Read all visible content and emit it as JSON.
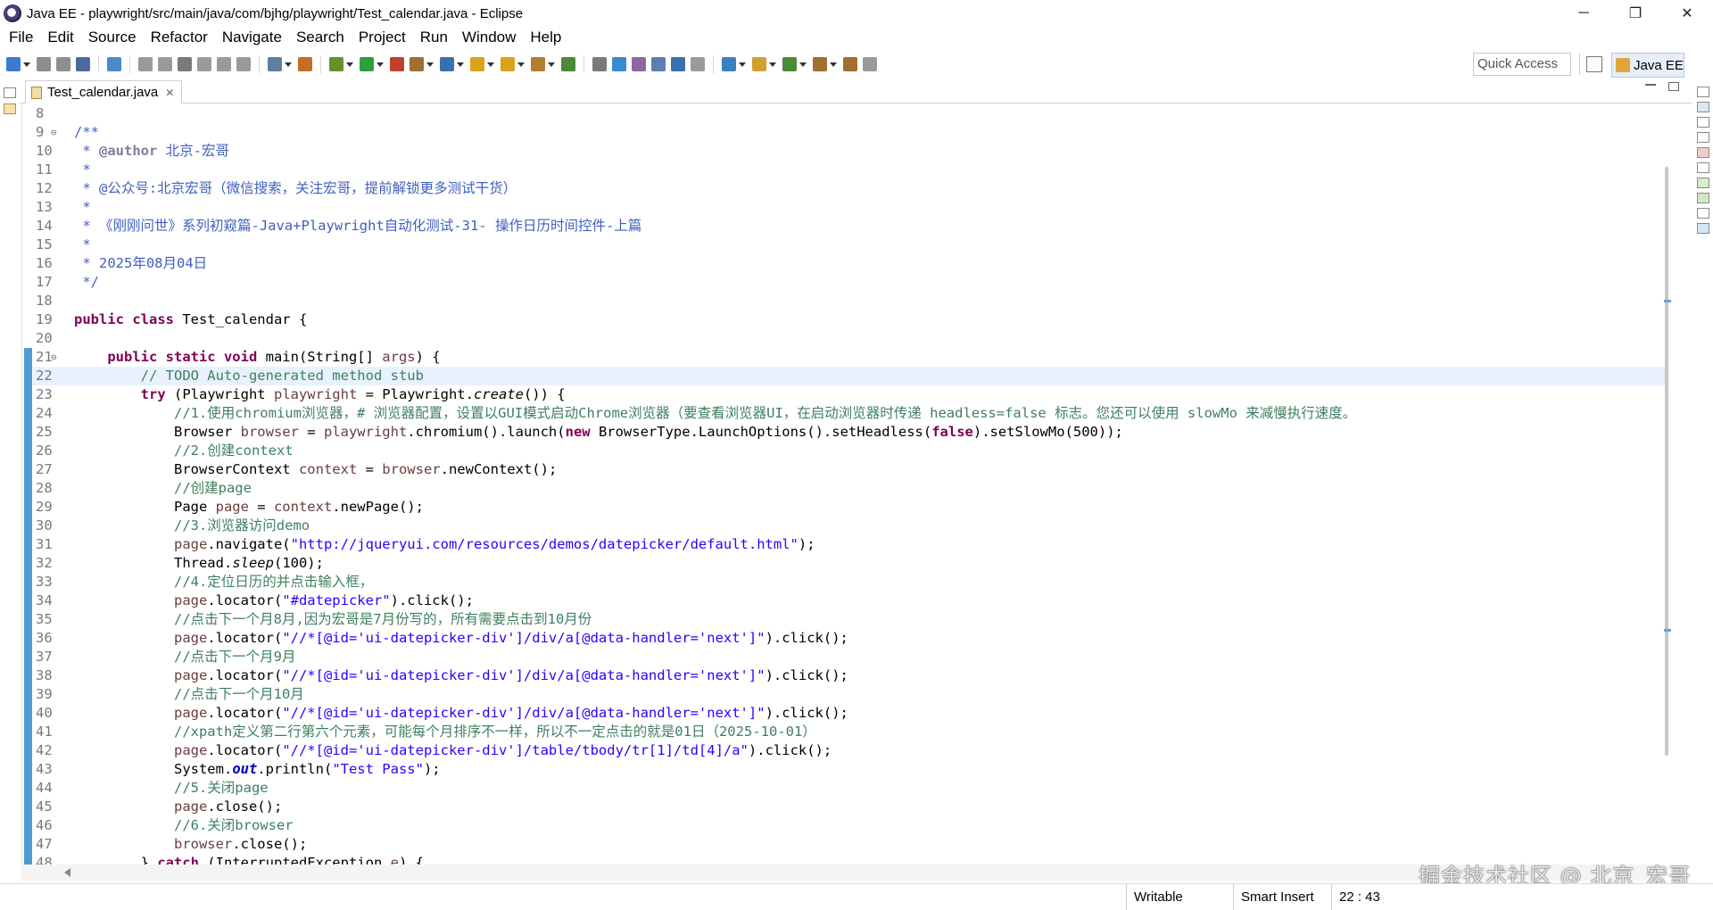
{
  "window": {
    "title": "Java EE - playwright/src/main/java/com/bjhg/playwright/Test_calendar.java - Eclipse",
    "controls": [
      "─",
      "❐",
      "✕"
    ]
  },
  "menu": [
    "File",
    "Edit",
    "Source",
    "Refactor",
    "Navigate",
    "Search",
    "Project",
    "Run",
    "Window",
    "Help"
  ],
  "toolbar": {
    "quick_access": "Quick Access",
    "perspective": "Java EE",
    "icon_colors": [
      "#3b7bd1",
      "#8e8e8e",
      "#8e8e8e",
      "#4c6b9c",
      "#4b8bc9",
      "#9a9a9a",
      "#9a9a9a",
      "#7a7a7a",
      "#9a9a9a",
      "#9a9a9a",
      "#9a9a9a",
      "#5f7f9f",
      "#c07020",
      "#6a8f2a",
      "#2f9e3f",
      "#c04030",
      "#a07030",
      "#3a70b0",
      "#d9a21a",
      "#d9a21a",
      "#b08030",
      "#4a8a3a",
      "#7a7a7a",
      "#3a8ad0",
      "#8a6aa0",
      "#5a80b0",
      "#3a70b0",
      "#9a9a9a",
      "#3a80c0",
      "#d0a030",
      "#4a8a3a",
      "#a07030",
      "#a07030",
      "#9a9a9a"
    ]
  },
  "editor": {
    "tab_title": "Test_calendar.java",
    "tab_close": "✕",
    "current_line": 22,
    "lines": [
      {
        "n": "8",
        "fold": "",
        "parts": []
      },
      {
        "n": "9",
        "fold": "⊖",
        "parts": [
          {
            "c": "jd",
            "t": "/**"
          }
        ]
      },
      {
        "n": "10",
        "fold": "",
        "parts": [
          {
            "c": "jd",
            "t": " * "
          },
          {
            "c": "jdt",
            "t": "@author"
          },
          {
            "c": "jd",
            "t": " 北京-宏哥"
          }
        ]
      },
      {
        "n": "11",
        "fold": "",
        "parts": [
          {
            "c": "jd",
            "t": " *"
          }
        ]
      },
      {
        "n": "12",
        "fold": "",
        "parts": [
          {
            "c": "jd",
            "t": " * @公众号:北京宏哥（微信搜索，关注宏哥，提前解锁更多测试干货）"
          }
        ]
      },
      {
        "n": "13",
        "fold": "",
        "parts": [
          {
            "c": "jd",
            "t": " *"
          }
        ]
      },
      {
        "n": "14",
        "fold": "",
        "parts": [
          {
            "c": "jd",
            "t": " * 《刚刚问世》系列初窥篇-Java+Playwright自动化测试-31- 操作日历时间控件-上篇"
          }
        ]
      },
      {
        "n": "15",
        "fold": "",
        "parts": [
          {
            "c": "jd",
            "t": " *"
          }
        ]
      },
      {
        "n": "16",
        "fold": "",
        "parts": [
          {
            "c": "jd",
            "t": " * 2025年08月04日"
          }
        ]
      },
      {
        "n": "17",
        "fold": "",
        "parts": [
          {
            "c": "jd",
            "t": " */"
          }
        ]
      },
      {
        "n": "18",
        "fold": "",
        "parts": []
      },
      {
        "n": "19",
        "fold": "",
        "parts": [
          {
            "c": "kw",
            "t": "public class"
          },
          {
            "c": "pl",
            "t": " Test_calendar {"
          }
        ]
      },
      {
        "n": "20",
        "fold": "",
        "parts": []
      },
      {
        "n": "21",
        "fold": "⊖",
        "parts": [
          {
            "c": "pl",
            "t": "    "
          },
          {
            "c": "kw",
            "t": "public static void"
          },
          {
            "c": "pl",
            "t": " main(String[] "
          },
          {
            "c": "var",
            "t": "args"
          },
          {
            "c": "pl",
            "t": ") {"
          }
        ]
      },
      {
        "n": "22",
        "fold": "",
        "parts": [
          {
            "c": "pl",
            "t": "        "
          },
          {
            "c": "cm",
            "t": "// TODO Auto-generated method stub"
          }
        ]
      },
      {
        "n": "23",
        "fold": "",
        "parts": [
          {
            "c": "pl",
            "t": "        "
          },
          {
            "c": "kw",
            "t": "try"
          },
          {
            "c": "pl",
            "t": " (Playwright "
          },
          {
            "c": "var",
            "t": "playwright"
          },
          {
            "c": "pl",
            "t": " = Playwright."
          },
          {
            "c": "st",
            "t": "create"
          },
          {
            "c": "pl",
            "t": "()) {"
          }
        ]
      },
      {
        "n": "24",
        "fold": "",
        "parts": [
          {
            "c": "pl",
            "t": "            "
          },
          {
            "c": "cm",
            "t": "//1.使用chromium浏览器，# 浏览器配置，设置以GUI模式启动Chrome浏览器（要查看浏览器UI，在启动浏览器时传递 headless=false 标志。您还可以使用 slowMo 来减慢执行速度。"
          }
        ]
      },
      {
        "n": "25",
        "fold": "",
        "parts": [
          {
            "c": "pl",
            "t": "            Browser "
          },
          {
            "c": "var",
            "t": "browser"
          },
          {
            "c": "pl",
            "t": " = "
          },
          {
            "c": "var",
            "t": "playwright"
          },
          {
            "c": "pl",
            "t": ".chromium().launch("
          },
          {
            "c": "kw",
            "t": "new"
          },
          {
            "c": "pl",
            "t": " BrowserType.LaunchOptions().setHeadless("
          },
          {
            "c": "kw",
            "t": "false"
          },
          {
            "c": "pl",
            "t": ").setSlowMo(500));"
          }
        ]
      },
      {
        "n": "26",
        "fold": "",
        "parts": [
          {
            "c": "pl",
            "t": "            "
          },
          {
            "c": "cm",
            "t": "//2.创建context"
          }
        ]
      },
      {
        "n": "27",
        "fold": "",
        "parts": [
          {
            "c": "pl",
            "t": "            BrowserContext "
          },
          {
            "c": "var",
            "t": "context"
          },
          {
            "c": "pl",
            "t": " = "
          },
          {
            "c": "var",
            "t": "browser"
          },
          {
            "c": "pl",
            "t": ".newContext();"
          }
        ]
      },
      {
        "n": "28",
        "fold": "",
        "parts": [
          {
            "c": "pl",
            "t": "            "
          },
          {
            "c": "cm",
            "t": "//创建page"
          }
        ]
      },
      {
        "n": "29",
        "fold": "",
        "parts": [
          {
            "c": "pl",
            "t": "            Page "
          },
          {
            "c": "var",
            "t": "page"
          },
          {
            "c": "pl",
            "t": " = "
          },
          {
            "c": "var",
            "t": "context"
          },
          {
            "c": "pl",
            "t": ".newPage();"
          }
        ]
      },
      {
        "n": "30",
        "fold": "",
        "parts": [
          {
            "c": "pl",
            "t": "            "
          },
          {
            "c": "cm",
            "t": "//3.浏览器访问demo"
          }
        ]
      },
      {
        "n": "31",
        "fold": "",
        "parts": [
          {
            "c": "pl",
            "t": "            "
          },
          {
            "c": "var",
            "t": "page"
          },
          {
            "c": "pl",
            "t": ".navigate("
          },
          {
            "c": "str",
            "t": "\"http://jqueryui.com/resources/demos/datepicker/default.html\""
          },
          {
            "c": "pl",
            "t": ");"
          }
        ]
      },
      {
        "n": "32",
        "fold": "",
        "parts": [
          {
            "c": "pl",
            "t": "            Thread."
          },
          {
            "c": "st",
            "t": "sleep"
          },
          {
            "c": "pl",
            "t": "(100);"
          }
        ]
      },
      {
        "n": "33",
        "fold": "",
        "parts": [
          {
            "c": "pl",
            "t": "            "
          },
          {
            "c": "cm",
            "t": "//4.定位日历的并点击输入框，"
          }
        ]
      },
      {
        "n": "34",
        "fold": "",
        "parts": [
          {
            "c": "pl",
            "t": "            "
          },
          {
            "c": "var",
            "t": "page"
          },
          {
            "c": "pl",
            "t": ".locator("
          },
          {
            "c": "str",
            "t": "\"#datepicker\""
          },
          {
            "c": "pl",
            "t": ").click();"
          }
        ]
      },
      {
        "n": "35",
        "fold": "",
        "parts": [
          {
            "c": "pl",
            "t": "            "
          },
          {
            "c": "cm",
            "t": "//点击下一个月8月,因为宏哥是7月份写的，所有需要点击到10月份"
          }
        ]
      },
      {
        "n": "36",
        "fold": "",
        "parts": [
          {
            "c": "pl",
            "t": "            "
          },
          {
            "c": "var",
            "t": "page"
          },
          {
            "c": "pl",
            "t": ".locator("
          },
          {
            "c": "str",
            "t": "\"//*[@id='ui-datepicker-div']/div/a[@data-handler='next']\""
          },
          {
            "c": "pl",
            "t": ").click();"
          }
        ]
      },
      {
        "n": "37",
        "fold": "",
        "parts": [
          {
            "c": "pl",
            "t": "            "
          },
          {
            "c": "cm",
            "t": "//点击下一个月9月"
          }
        ]
      },
      {
        "n": "38",
        "fold": "",
        "parts": [
          {
            "c": "pl",
            "t": "            "
          },
          {
            "c": "var",
            "t": "page"
          },
          {
            "c": "pl",
            "t": ".locator("
          },
          {
            "c": "str",
            "t": "\"//*[@id='ui-datepicker-div']/div/a[@data-handler='next']\""
          },
          {
            "c": "pl",
            "t": ").click();"
          }
        ]
      },
      {
        "n": "39",
        "fold": "",
        "parts": [
          {
            "c": "pl",
            "t": "            "
          },
          {
            "c": "cm",
            "t": "//点击下一个月10月"
          }
        ]
      },
      {
        "n": "40",
        "fold": "",
        "parts": [
          {
            "c": "pl",
            "t": "            "
          },
          {
            "c": "var",
            "t": "page"
          },
          {
            "c": "pl",
            "t": ".locator("
          },
          {
            "c": "str",
            "t": "\"//*[@id='ui-datepicker-div']/div/a[@data-handler='next']\""
          },
          {
            "c": "pl",
            "t": ").click();"
          }
        ]
      },
      {
        "n": "41",
        "fold": "",
        "parts": [
          {
            "c": "pl",
            "t": "            "
          },
          {
            "c": "cm",
            "t": "//xpath定义第二行第六个元素，可能每个月排序不一样，所以不一定点击的就是01日（2025-10-01）"
          }
        ]
      },
      {
        "n": "42",
        "fold": "",
        "parts": [
          {
            "c": "pl",
            "t": "            "
          },
          {
            "c": "var",
            "t": "page"
          },
          {
            "c": "pl",
            "t": ".locator("
          },
          {
            "c": "str",
            "t": "\"//*[@id='ui-datepicker-div']/table/tbody/tr[1]/td[4]/a\""
          },
          {
            "c": "pl",
            "t": ").click();"
          }
        ]
      },
      {
        "n": "43",
        "fold": "",
        "parts": [
          {
            "c": "pl",
            "t": "            System."
          },
          {
            "c": "fld",
            "t": "out"
          },
          {
            "c": "pl",
            "t": ".println("
          },
          {
            "c": "str",
            "t": "\"Test Pass\""
          },
          {
            "c": "pl",
            "t": ");"
          }
        ]
      },
      {
        "n": "44",
        "fold": "",
        "parts": [
          {
            "c": "pl",
            "t": "            "
          },
          {
            "c": "cm",
            "t": "//5.关闭page"
          }
        ]
      },
      {
        "n": "45",
        "fold": "",
        "parts": [
          {
            "c": "pl",
            "t": "            "
          },
          {
            "c": "var",
            "t": "page"
          },
          {
            "c": "pl",
            "t": ".close();"
          }
        ]
      },
      {
        "n": "46",
        "fold": "",
        "parts": [
          {
            "c": "pl",
            "t": "            "
          },
          {
            "c": "cm",
            "t": "//6.关闭browser"
          }
        ]
      },
      {
        "n": "47",
        "fold": "",
        "parts": [
          {
            "c": "pl",
            "t": "            "
          },
          {
            "c": "var",
            "t": "browser"
          },
          {
            "c": "pl",
            "t": ".close();"
          }
        ]
      },
      {
        "n": "48",
        "fold": "",
        "parts": [
          {
            "c": "pl",
            "t": "        } "
          },
          {
            "c": "kw",
            "t": "catch"
          },
          {
            "c": "pl",
            "t": " (InterruptedException "
          },
          {
            "c": "var",
            "t": "e"
          },
          {
            "c": "pl",
            "t": ") {"
          }
        ]
      }
    ]
  },
  "status": {
    "writable": "Writable",
    "insert_mode": "Smart Insert",
    "position": "22 : 43"
  },
  "watermark": "掘金技术社区 @ 北京_宏哥"
}
